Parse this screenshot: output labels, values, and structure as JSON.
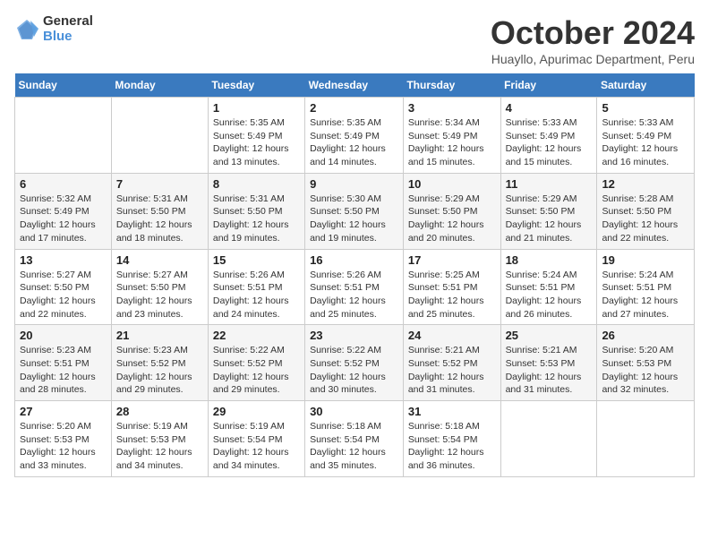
{
  "logo": {
    "general": "General",
    "blue": "Blue"
  },
  "title": "October 2024",
  "subtitle": "Huayllo, Apurimac Department, Peru",
  "days_header": [
    "Sunday",
    "Monday",
    "Tuesday",
    "Wednesday",
    "Thursday",
    "Friday",
    "Saturday"
  ],
  "weeks": [
    [
      {
        "day": "",
        "sunrise": "",
        "sunset": "",
        "daylight": ""
      },
      {
        "day": "",
        "sunrise": "",
        "sunset": "",
        "daylight": ""
      },
      {
        "day": "1",
        "sunrise": "Sunrise: 5:35 AM",
        "sunset": "Sunset: 5:49 PM",
        "daylight": "Daylight: 12 hours and 13 minutes."
      },
      {
        "day": "2",
        "sunrise": "Sunrise: 5:35 AM",
        "sunset": "Sunset: 5:49 PM",
        "daylight": "Daylight: 12 hours and 14 minutes."
      },
      {
        "day": "3",
        "sunrise": "Sunrise: 5:34 AM",
        "sunset": "Sunset: 5:49 PM",
        "daylight": "Daylight: 12 hours and 15 minutes."
      },
      {
        "day": "4",
        "sunrise": "Sunrise: 5:33 AM",
        "sunset": "Sunset: 5:49 PM",
        "daylight": "Daylight: 12 hours and 15 minutes."
      },
      {
        "day": "5",
        "sunrise": "Sunrise: 5:33 AM",
        "sunset": "Sunset: 5:49 PM",
        "daylight": "Daylight: 12 hours and 16 minutes."
      }
    ],
    [
      {
        "day": "6",
        "sunrise": "Sunrise: 5:32 AM",
        "sunset": "Sunset: 5:49 PM",
        "daylight": "Daylight: 12 hours and 17 minutes."
      },
      {
        "day": "7",
        "sunrise": "Sunrise: 5:31 AM",
        "sunset": "Sunset: 5:50 PM",
        "daylight": "Daylight: 12 hours and 18 minutes."
      },
      {
        "day": "8",
        "sunrise": "Sunrise: 5:31 AM",
        "sunset": "Sunset: 5:50 PM",
        "daylight": "Daylight: 12 hours and 19 minutes."
      },
      {
        "day": "9",
        "sunrise": "Sunrise: 5:30 AM",
        "sunset": "Sunset: 5:50 PM",
        "daylight": "Daylight: 12 hours and 19 minutes."
      },
      {
        "day": "10",
        "sunrise": "Sunrise: 5:29 AM",
        "sunset": "Sunset: 5:50 PM",
        "daylight": "Daylight: 12 hours and 20 minutes."
      },
      {
        "day": "11",
        "sunrise": "Sunrise: 5:29 AM",
        "sunset": "Sunset: 5:50 PM",
        "daylight": "Daylight: 12 hours and 21 minutes."
      },
      {
        "day": "12",
        "sunrise": "Sunrise: 5:28 AM",
        "sunset": "Sunset: 5:50 PM",
        "daylight": "Daylight: 12 hours and 22 minutes."
      }
    ],
    [
      {
        "day": "13",
        "sunrise": "Sunrise: 5:27 AM",
        "sunset": "Sunset: 5:50 PM",
        "daylight": "Daylight: 12 hours and 22 minutes."
      },
      {
        "day": "14",
        "sunrise": "Sunrise: 5:27 AM",
        "sunset": "Sunset: 5:50 PM",
        "daylight": "Daylight: 12 hours and 23 minutes."
      },
      {
        "day": "15",
        "sunrise": "Sunrise: 5:26 AM",
        "sunset": "Sunset: 5:51 PM",
        "daylight": "Daylight: 12 hours and 24 minutes."
      },
      {
        "day": "16",
        "sunrise": "Sunrise: 5:26 AM",
        "sunset": "Sunset: 5:51 PM",
        "daylight": "Daylight: 12 hours and 25 minutes."
      },
      {
        "day": "17",
        "sunrise": "Sunrise: 5:25 AM",
        "sunset": "Sunset: 5:51 PM",
        "daylight": "Daylight: 12 hours and 25 minutes."
      },
      {
        "day": "18",
        "sunrise": "Sunrise: 5:24 AM",
        "sunset": "Sunset: 5:51 PM",
        "daylight": "Daylight: 12 hours and 26 minutes."
      },
      {
        "day": "19",
        "sunrise": "Sunrise: 5:24 AM",
        "sunset": "Sunset: 5:51 PM",
        "daylight": "Daylight: 12 hours and 27 minutes."
      }
    ],
    [
      {
        "day": "20",
        "sunrise": "Sunrise: 5:23 AM",
        "sunset": "Sunset: 5:51 PM",
        "daylight": "Daylight: 12 hours and 28 minutes."
      },
      {
        "day": "21",
        "sunrise": "Sunrise: 5:23 AM",
        "sunset": "Sunset: 5:52 PM",
        "daylight": "Daylight: 12 hours and 29 minutes."
      },
      {
        "day": "22",
        "sunrise": "Sunrise: 5:22 AM",
        "sunset": "Sunset: 5:52 PM",
        "daylight": "Daylight: 12 hours and 29 minutes."
      },
      {
        "day": "23",
        "sunrise": "Sunrise: 5:22 AM",
        "sunset": "Sunset: 5:52 PM",
        "daylight": "Daylight: 12 hours and 30 minutes."
      },
      {
        "day": "24",
        "sunrise": "Sunrise: 5:21 AM",
        "sunset": "Sunset: 5:52 PM",
        "daylight": "Daylight: 12 hours and 31 minutes."
      },
      {
        "day": "25",
        "sunrise": "Sunrise: 5:21 AM",
        "sunset": "Sunset: 5:53 PM",
        "daylight": "Daylight: 12 hours and 31 minutes."
      },
      {
        "day": "26",
        "sunrise": "Sunrise: 5:20 AM",
        "sunset": "Sunset: 5:53 PM",
        "daylight": "Daylight: 12 hours and 32 minutes."
      }
    ],
    [
      {
        "day": "27",
        "sunrise": "Sunrise: 5:20 AM",
        "sunset": "Sunset: 5:53 PM",
        "daylight": "Daylight: 12 hours and 33 minutes."
      },
      {
        "day": "28",
        "sunrise": "Sunrise: 5:19 AM",
        "sunset": "Sunset: 5:53 PM",
        "daylight": "Daylight: 12 hours and 34 minutes."
      },
      {
        "day": "29",
        "sunrise": "Sunrise: 5:19 AM",
        "sunset": "Sunset: 5:54 PM",
        "daylight": "Daylight: 12 hours and 34 minutes."
      },
      {
        "day": "30",
        "sunrise": "Sunrise: 5:18 AM",
        "sunset": "Sunset: 5:54 PM",
        "daylight": "Daylight: 12 hours and 35 minutes."
      },
      {
        "day": "31",
        "sunrise": "Sunrise: 5:18 AM",
        "sunset": "Sunset: 5:54 PM",
        "daylight": "Daylight: 12 hours and 36 minutes."
      },
      {
        "day": "",
        "sunrise": "",
        "sunset": "",
        "daylight": ""
      },
      {
        "day": "",
        "sunrise": "",
        "sunset": "",
        "daylight": ""
      }
    ]
  ]
}
